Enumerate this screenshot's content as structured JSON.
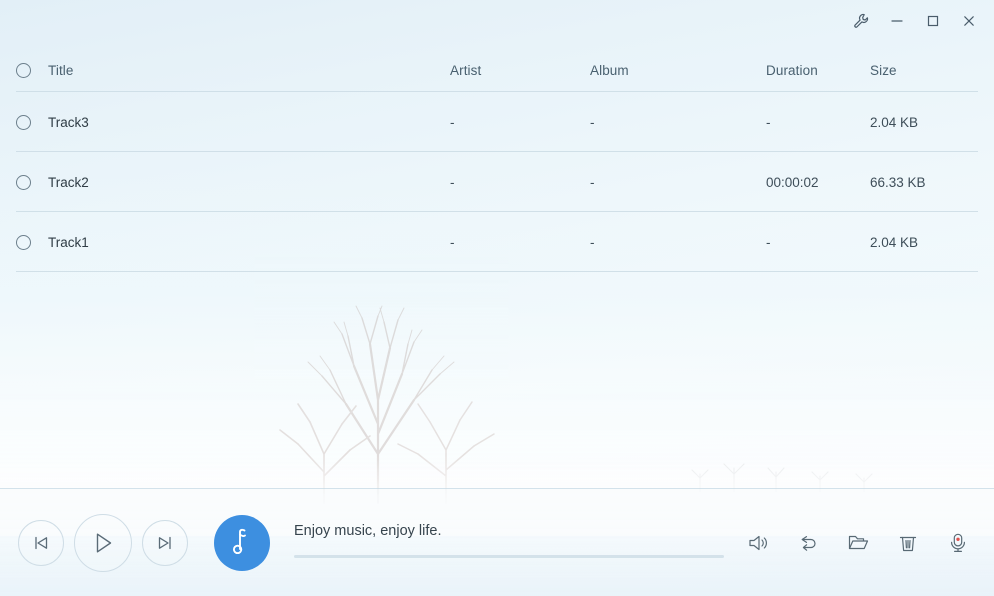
{
  "window": {
    "controls": [
      {
        "name": "settings-wrench",
        "label": "Settings",
        "icon": "wrench-icon"
      },
      {
        "name": "minimize",
        "label": "Minimize",
        "icon": "minimize-icon"
      },
      {
        "name": "maximize",
        "label": "Maximize",
        "icon": "maximize-icon"
      },
      {
        "name": "close",
        "label": "Close",
        "icon": "close-icon"
      }
    ]
  },
  "table": {
    "headers": {
      "title": "Title",
      "artist": "Artist",
      "album": "Album",
      "duration": "Duration",
      "size": "Size"
    },
    "select_all_checked": false,
    "rows": [
      {
        "checked": false,
        "title": "Track3",
        "artist": "-",
        "album": "-",
        "duration": "-",
        "size": "2.04 KB"
      },
      {
        "checked": false,
        "title": "Track2",
        "artist": "-",
        "album": "-",
        "duration": "00:00:02",
        "size": "66.33 KB"
      },
      {
        "checked": false,
        "title": "Track1",
        "artist": "-",
        "album": "-",
        "duration": "-",
        "size": "2.04 KB"
      }
    ]
  },
  "player": {
    "previous_label": "Previous",
    "play_label": "Play",
    "next_label": "Next",
    "album_art_icon": "music-note-icon",
    "now_playing_text": "Enjoy music, enjoy life.",
    "progress_percent": 0,
    "accent_color": "#3d8fe0",
    "tools": [
      {
        "name": "volume",
        "label": "Volume",
        "icon": "speaker-icon"
      },
      {
        "name": "repeat",
        "label": "Repeat",
        "icon": "loop-icon"
      },
      {
        "name": "open-folder",
        "label": "Open folder",
        "icon": "folder-icon"
      },
      {
        "name": "delete",
        "label": "Delete",
        "icon": "trash-icon"
      },
      {
        "name": "record",
        "label": "Record",
        "icon": "microphone-icon"
      }
    ]
  }
}
